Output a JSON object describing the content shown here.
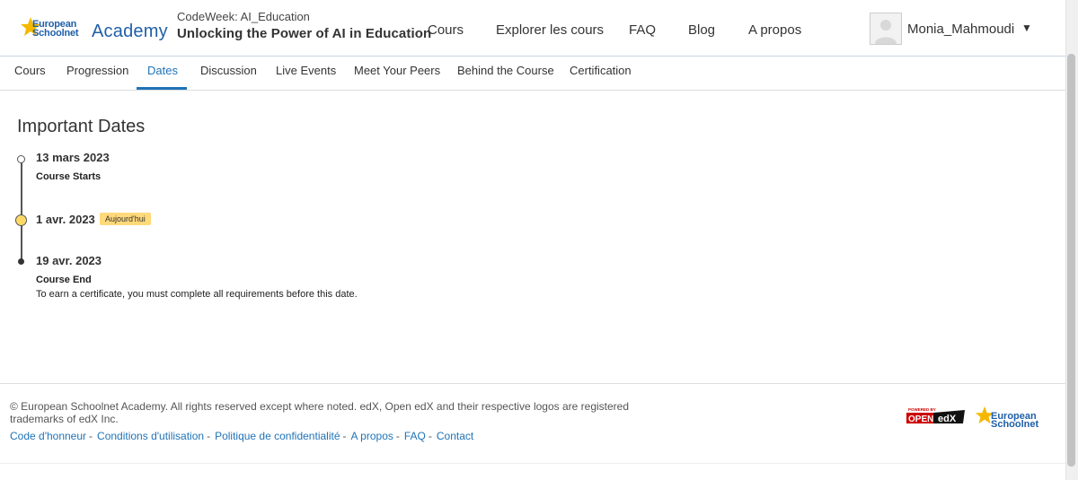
{
  "header": {
    "logo_line1": "European",
    "logo_line2": "Schoolnet",
    "logo_academy": "Academy",
    "course_org": "CodeWeek: AI_Education",
    "course_title": "Unlocking the Power of AI in Education",
    "nav": [
      "Cours",
      "Explorer les cours",
      "FAQ",
      "Blog",
      "A propos"
    ],
    "username": "Monia_Mahmoudi",
    "user_caret": "▼"
  },
  "tabs": {
    "items": [
      "Cours",
      "Progression",
      "Dates",
      "Discussion",
      "Live Events",
      "Meet Your Peers",
      "Behind the Course",
      "Certification"
    ],
    "active": "Dates"
  },
  "main": {
    "title": "Important Dates",
    "events": [
      {
        "date": "13 mars 2023",
        "label": "Course Starts",
        "description": ""
      },
      {
        "date": "1 avr. 2023",
        "badge": "Aujourd'hui"
      },
      {
        "date": "19 avr. 2023",
        "label": "Course End",
        "description": "To earn a certificate, you must complete all requirements before this date."
      }
    ]
  },
  "footer": {
    "copyright": "© European Schoolnet Academy. All rights reserved except where noted. edX, Open edX and their respective logos are registered trademarks of edX Inc.",
    "links": [
      "Code d'honneur",
      "Conditions d'utilisation",
      "Politique de confidentialité",
      "A propos",
      "FAQ",
      "Contact"
    ],
    "openedx_powered": "POWERED BY",
    "openedx_open": "OPEN",
    "openedx_edx": "edX",
    "eu_logo_line1": "European",
    "eu_logo_line2": "Schoolnet"
  },
  "colors": {
    "accent": "#1f73b7",
    "brand": "#1f5fa8",
    "today_badge": "#ffd97a"
  }
}
